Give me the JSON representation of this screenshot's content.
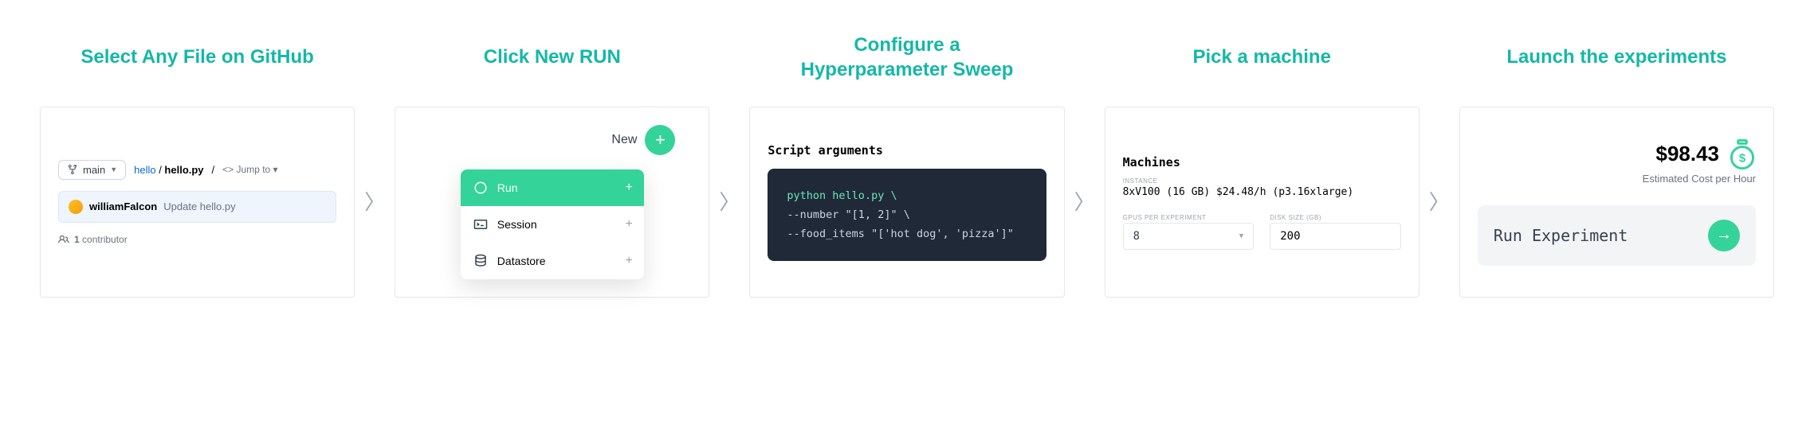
{
  "steps": {
    "s1": {
      "title": "Select Any File on GitHub"
    },
    "s2": {
      "title": "Click New RUN"
    },
    "s3": {
      "title": "Configure a\nHyperparameter Sweep"
    },
    "s4": {
      "title": "Pick a machine"
    },
    "s5": {
      "title": "Launch the experiments"
    }
  },
  "github": {
    "branch_label": "main",
    "path_repo": "hello",
    "path_file": "hello.py",
    "jump_label": "Jump to",
    "author": "williamFalcon",
    "commit_msg": "Update hello.py",
    "contrib_count": "1",
    "contrib_word": "contributor"
  },
  "newmenu": {
    "new_label": "New",
    "items": [
      {
        "label": "Run"
      },
      {
        "label": "Session"
      },
      {
        "label": "Datastore"
      }
    ]
  },
  "script": {
    "header": "Script arguments",
    "line1": "python hello.py \\",
    "line2": "--number \"[1, 2]\" \\",
    "line3": "--food_items \"['hot dog', 'pizza']\""
  },
  "machines": {
    "header": "Machines",
    "instance_tiny": "INSTANCE",
    "instance": "8xV100 (16 GB) $24.48/h (p3.16xlarge)",
    "gpu_tiny": "GPUS PER EXPERIMENT",
    "gpu_val": "8",
    "disk_tiny": "DISK SIZE (GB)",
    "disk_val": "200"
  },
  "launch": {
    "cost": "$98.43",
    "cost_sub": "Estimated Cost per Hour",
    "button": "Run Experiment"
  },
  "colors": {
    "accent": "#14b8a6",
    "green": "#34d399"
  }
}
